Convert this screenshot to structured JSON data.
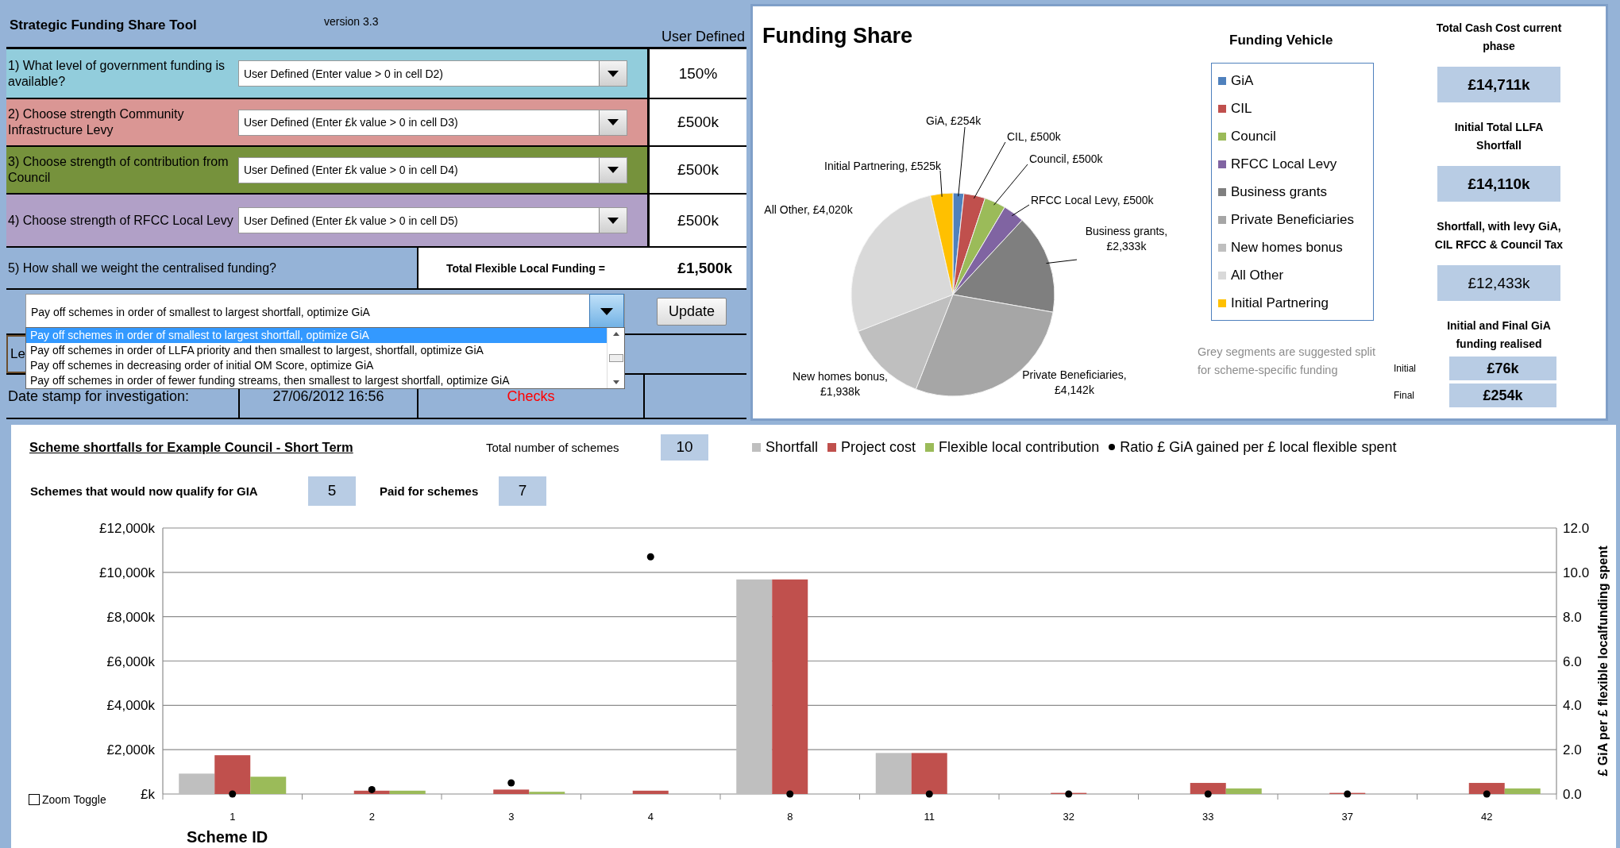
{
  "tool": {
    "title": "Strategic Funding Share Tool",
    "version": "version 3.3",
    "column_heading": "User Defined"
  },
  "questions": [
    {
      "label": "1) What level of government funding is available?",
      "dropdown": "User Defined (Enter value > 0 in cell D2)",
      "value": "150%",
      "color": "#92cddc"
    },
    {
      "label": "2) Choose strength Community Infrastructure Levy",
      "dropdown": "User Defined (Enter £k value > 0 in cell D3)",
      "value": "£500k",
      "color": "#da9694"
    },
    {
      "label": "3) Choose strength of contribution from Council",
      "dropdown": "User Defined (Enter £k value > 0 in cell D4)",
      "value": "£500k",
      "color": "#76923c"
    },
    {
      "label": "4) Choose strength of RFCC Local Levy",
      "dropdown": "User Defined (Enter £k value > 0 in cell D5)",
      "value": "£500k",
      "color": "#b1a0c7"
    }
  ],
  "weighting": {
    "label": "5) How shall we weight the centralised funding?",
    "total_label": "Total Flexible Local Funding =",
    "total_value": "£1,500k",
    "dropdown": "Pay off schemes in order of smallest to largest shortfall, optimize GiA",
    "update_button": "Update",
    "partial_label": "Le",
    "options": [
      {
        "text": "Pay off schemes in order of smallest to largest shortfall, optimize GiA",
        "selected": true
      },
      {
        "text": "Pay off schemes in order of LLFA priority and then smallest to largest, shortfall, optimize GiA",
        "selected": false
      },
      {
        "text": "Pay off schemes in decreasing order of initial OM Score, optimize GiA",
        "selected": false
      },
      {
        "text": "Pay off schemes in order of fewer funding streams, then smallest to largest shortfall, optimize GiA",
        "selected": false
      }
    ]
  },
  "date_stamp": {
    "label": "Date stamp for investigation:",
    "value": "27/06/2012 16:56",
    "checks": "Checks"
  },
  "funding_share": {
    "title": "Funding Share",
    "chart_data": {
      "type": "pie",
      "categories": [
        "GiA",
        "CIL",
        "Council",
        "RFCC Local Levy",
        "Business grants",
        "Private Beneficiaries",
        "New homes bonus",
        "All Other",
        "Initial Partnering"
      ],
      "values": [
        254,
        500,
        500,
        500,
        2333,
        4142,
        1938,
        4020,
        525
      ],
      "colors": [
        "#4f81bd",
        "#c0504d",
        "#9bbb59",
        "#8064a2",
        "#7f7f7f",
        "#a6a6a6",
        "#bfbfbf",
        "#d9d9d9",
        "#ffc000"
      ],
      "value_labels": [
        "GiA, £254k",
        "CIL, £500k",
        "Council, £500k",
        "RFCC Local Levy, £500k",
        "Business grants, £2,333k",
        "Private Beneficiaries, £4,142k",
        "New homes bonus, £1,938k",
        "All Other, £4,020k",
        "Initial Partnering, £525k"
      ]
    },
    "legend": {
      "title": "Funding Vehicle"
    },
    "note": "Grey segments are suggested split for scheme-specific funding",
    "stats": [
      {
        "label": "Total Cash Cost current phase",
        "value": "£14,711k",
        "emphasis": true
      },
      {
        "label": "Initial  Total  LLFA Shortfall",
        "value": "£14,110k",
        "emphasis": true
      },
      {
        "label": "Shortfall, with levy GiA, CIL RFCC & Council Tax",
        "value": "£12,433k",
        "emphasis": false
      }
    ],
    "gia_realised": {
      "label": "Initial and Final GiA funding realised",
      "rows": [
        {
          "label": "Initial",
          "value": "£76k"
        },
        {
          "label": "Final",
          "value": "£254k"
        }
      ]
    }
  },
  "scheme_chart": {
    "title": "Scheme shortfalls for Example Council  - Short  Term",
    "total_label": "Total number of schemes",
    "total_value": "10",
    "qualify_label": "Schemes that would now qualify for GIA",
    "qualify_value": "5",
    "paid_label": "Paid for schemes",
    "paid_value": "7",
    "zoom_toggle": {
      "label": "Zoom Toggle",
      "checked": false
    },
    "chart_data": {
      "type": "bar",
      "xlabel": "Scheme ID",
      "y2label": "£ GiA per £ flexible localfunding spent",
      "categories": [
        "1",
        "2",
        "3",
        "4",
        "8",
        "11",
        "32",
        "33",
        "37",
        "42"
      ],
      "series": [
        {
          "name": "Shortfall",
          "color": "#bfbfbf",
          "values": [
            920,
            0,
            0,
            0,
            9680,
            1850,
            0,
            0,
            0,
            0
          ]
        },
        {
          "name": "Project cost",
          "color": "#c0504d",
          "values": [
            1750,
            150,
            200,
            150,
            9680,
            1850,
            50,
            500,
            50,
            500
          ]
        },
        {
          "name": "Flexible local contribution",
          "color": "#9bbb59",
          "values": [
            780,
            150,
            100,
            0,
            0,
            0,
            0,
            250,
            0,
            250
          ]
        },
        {
          "name": "Ratio £ GiA gained per £ local flexible spent",
          "color": "#000000",
          "type": "scatter",
          "axis": "y2",
          "values": [
            0,
            0.2,
            0.5,
            10.7,
            0,
            0,
            0,
            0,
            0,
            0
          ]
        }
      ],
      "grid": true,
      "ylim": [
        0,
        12000
      ],
      "yticks": [
        {
          "value": 0,
          "label": "£k"
        },
        {
          "value": 2000,
          "label": "£2,000k"
        },
        {
          "value": 4000,
          "label": "£4,000k"
        },
        {
          "value": 6000,
          "label": "£6,000k"
        },
        {
          "value": 8000,
          "label": "£8,000k"
        },
        {
          "value": 10000,
          "label": "£10,000k"
        },
        {
          "value": 12000,
          "label": "£12,000k"
        }
      ],
      "y2lim": [
        0,
        12
      ],
      "y2ticks": [
        {
          "value": 0,
          "label": "0.0"
        },
        {
          "value": 2,
          "label": "2.0"
        },
        {
          "value": 4,
          "label": "4.0"
        },
        {
          "value": 6,
          "label": "6.0"
        },
        {
          "value": 8,
          "label": "8.0"
        },
        {
          "value": 10,
          "label": "10.0"
        },
        {
          "value": 12,
          "label": "12.0"
        }
      ]
    }
  }
}
